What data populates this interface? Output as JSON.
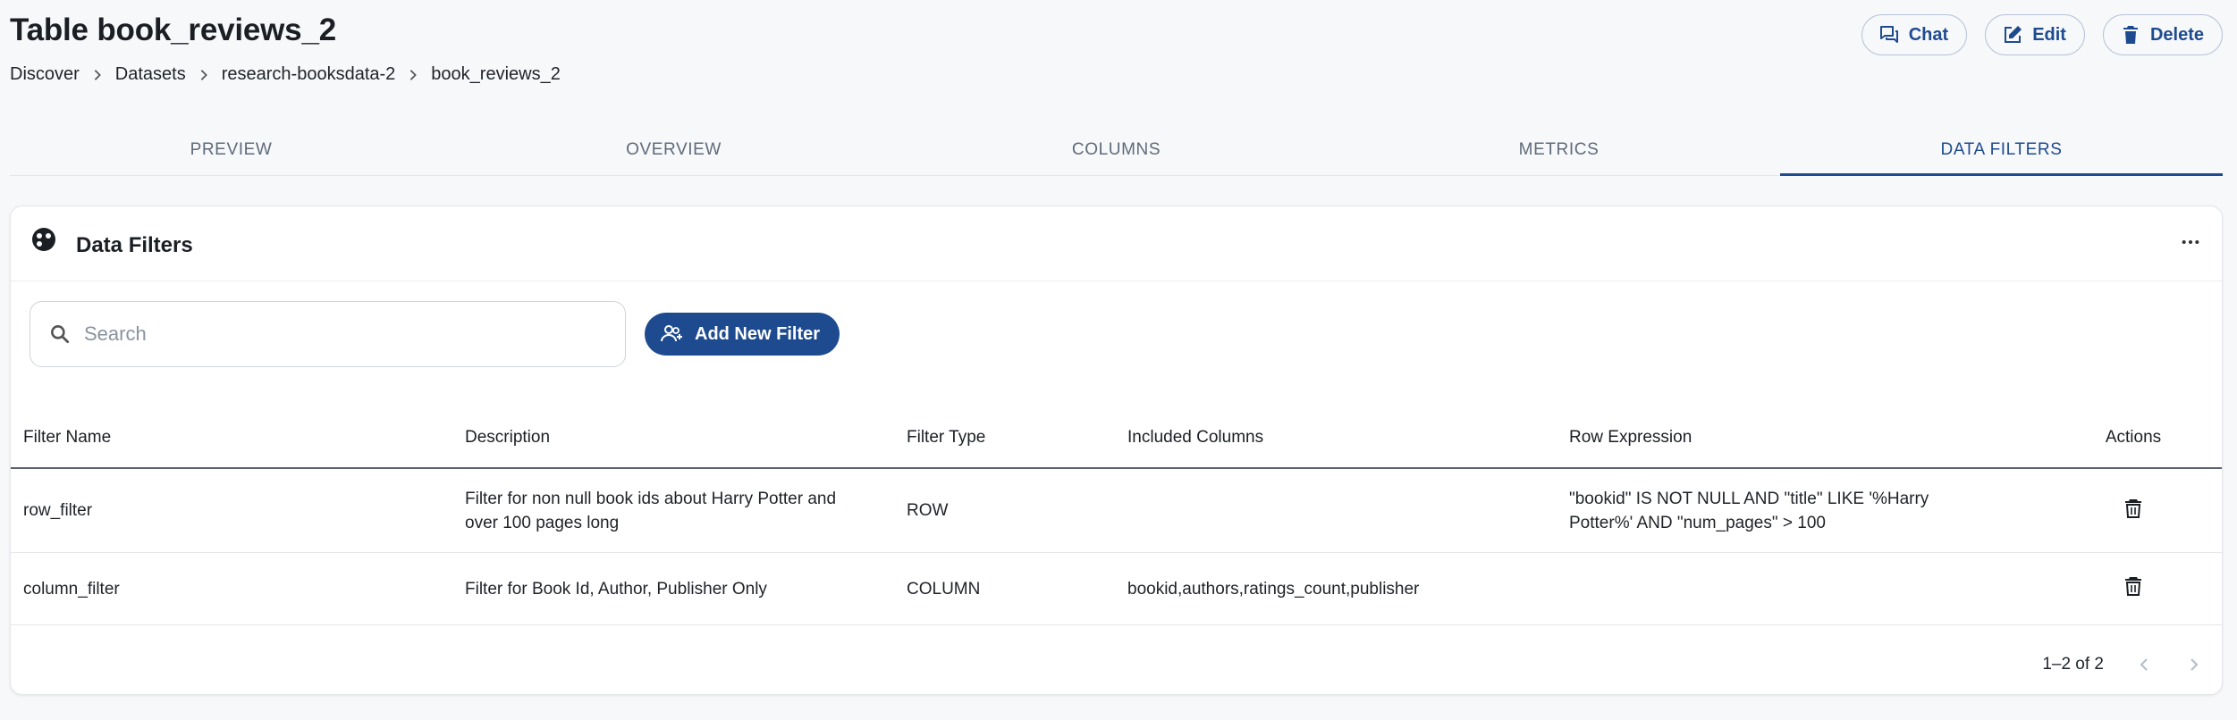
{
  "page": {
    "title": "Table book_reviews_2",
    "breadcrumb": [
      "Discover",
      "Datasets",
      "research-booksdata-2",
      "book_reviews_2"
    ]
  },
  "header_actions": {
    "chat_label": "Chat",
    "edit_label": "Edit",
    "delete_label": "Delete"
  },
  "tabs": [
    {
      "label": "PREVIEW",
      "active": false
    },
    {
      "label": "OVERVIEW",
      "active": false
    },
    {
      "label": "COLUMNS",
      "active": false
    },
    {
      "label": "METRICS",
      "active": false
    },
    {
      "label": "DATA FILTERS",
      "active": true
    }
  ],
  "card": {
    "title": "Data Filters",
    "icon": "palette-icon",
    "more_icon": "more-horizontal-icon"
  },
  "search": {
    "placeholder": "Search",
    "value": ""
  },
  "add_filter": {
    "label": "Add New Filter",
    "icon": "add-user-icon"
  },
  "table": {
    "headers": [
      "Filter Name",
      "Description",
      "Filter Type",
      "Included Columns",
      "Row Expression",
      "Actions"
    ],
    "rows": [
      {
        "name": "row_filter",
        "description": "Filter for non null book ids about Harry Potter and over 100 pages long",
        "type": "ROW",
        "columns": "",
        "expression": "\"bookid\" IS NOT NULL AND \"title\" LIKE '%Harry Potter%' AND \"num_pages\" > 100"
      },
      {
        "name": "column_filter",
        "description": "Filter for Book Id, Author, Publisher Only",
        "type": "COLUMN",
        "columns": "bookid,authors,ratings_count,publisher",
        "expression": ""
      }
    ]
  },
  "pagination": {
    "label": "1–2 of 2"
  },
  "colors": {
    "accent": "#1e4b8f",
    "background": "#f7f8fa"
  }
}
